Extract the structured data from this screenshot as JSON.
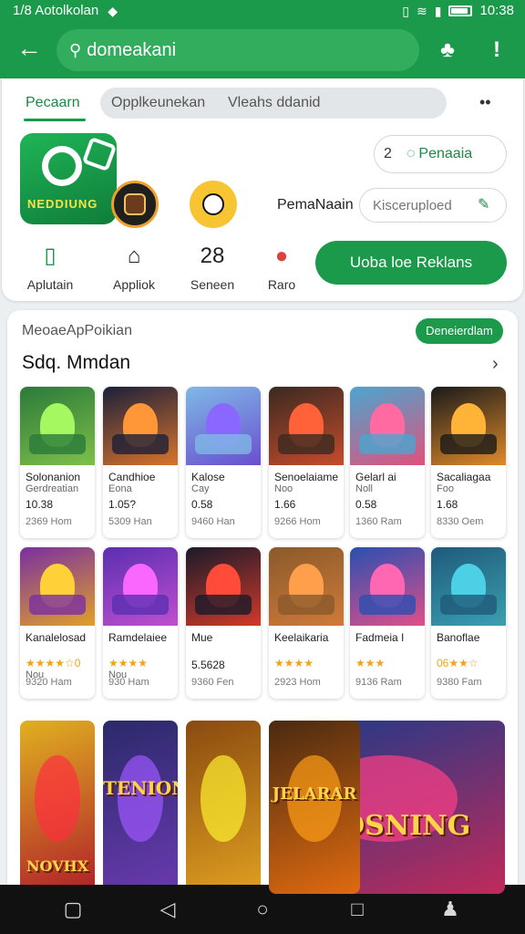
{
  "status": {
    "left_text": "1/8 Aotolkolan",
    "time": "10:38"
  },
  "appbar": {
    "search_query": "domeakani"
  },
  "header": {
    "tab_active": "Pecaarn",
    "tab_pill_1": "Opplkeunekan",
    "tab_pill_2": "Vleahs ddanid",
    "logo_text": "NEDDIUNG",
    "pill_search_num": "2",
    "pill_search_label": "Penaaia",
    "perma_label": "PemaNaain",
    "perma_placeholder": "Kisceruploed",
    "actions": [
      {
        "icon": "clipboard-icon",
        "glyph": "▯",
        "label": "Aplutain"
      },
      {
        "icon": "pack-icon",
        "glyph": "⌂",
        "label": "Appliok"
      },
      {
        "icon": "number-icon",
        "glyph": "28",
        "label": "Seneen"
      },
      {
        "icon": "location-icon",
        "glyph": "●",
        "label": "Raro"
      }
    ],
    "cta_label": "Uoba loe Reklans"
  },
  "section": {
    "subtitle": "MeoaeApPoikian",
    "chip": "Deneierdlam",
    "title": "Sdq. Mmdan"
  },
  "tiles_row1": [
    {
      "name": "Solonanion",
      "sub": "Gerdreatian",
      "value": "10.38",
      "meta": "2369 Hom",
      "c1": "#2a7a3a",
      "c2": "#7fbf4a"
    },
    {
      "name": "Candhioe",
      "sub": "Eona",
      "value": "1.05?",
      "meta": "5309 Han",
      "c1": "#1b1f3a",
      "c2": "#d9742b"
    },
    {
      "name": "Kalose",
      "sub": "Cay",
      "value": "0.58",
      "meta": "9460 Han",
      "c1": "#7fb8e6",
      "c2": "#6a4fcf"
    },
    {
      "name": "Senoelaiame",
      "sub": "Noo",
      "value": "1.66",
      "meta": "9266 Hom",
      "c1": "#3a2a20",
      "c2": "#c74b2c"
    },
    {
      "name": "Gelarl ai",
      "sub": "Noll",
      "value": "0.58",
      "meta": "1360 Ram",
      "c1": "#4aa6cf",
      "c2": "#e0527c"
    },
    {
      "name": "Sacaliagaa",
      "sub": "Foo",
      "value": "1.68",
      "meta": "8330 Oem",
      "c1": "#1a1a1a",
      "c2": "#e08a2a"
    }
  ],
  "tiles_row2": [
    {
      "name": "Kanalelosad",
      "stars": "★★★★☆0",
      "sub": "Nou",
      "meta": "9320 Ham",
      "c1": "#7a2fa0",
      "c2": "#e0a02a"
    },
    {
      "name": "Ramdelaiee",
      "stars": "★★★★",
      "sub": "Nou",
      "meta": "930 Ham",
      "c1": "#5a2fb0",
      "c2": "#c04fd0"
    },
    {
      "name": "Mue",
      "value": "5.5628",
      "sub": "",
      "meta": "9360 Fen",
      "c1": "#1a1a2a",
      "c2": "#d03a2a"
    },
    {
      "name": "Keelaikaria",
      "stars": "★★★★",
      "sub": "",
      "meta": "2923 Hom",
      "c1": "#8a5a2a",
      "c2": "#d07a3a"
    },
    {
      "name": "Fadmeia I",
      "stars": "★★★",
      "sub": "",
      "meta": "9136 Ram",
      "c1": "#2a4fb0",
      "c2": "#e04f8a"
    },
    {
      "name": "Banoflae",
      "stars": "06★★☆",
      "sub": "",
      "meta": "9380 Fam",
      "c1": "#1f5a7a",
      "c2": "#3aa0b0"
    }
  ],
  "promos": [
    {
      "text": "NOVHX",
      "c1": "#e0b020",
      "c2": "#b01f2a"
    },
    {
      "text": "TENION",
      "c1": "#2a2a6a",
      "c2": "#6a3ab0"
    },
    {
      "text": "",
      "c1": "#8a4a10",
      "c2": "#e0a020"
    },
    {
      "text": "JELARAR",
      "c1": "#4a2a10",
      "c2": "#e06a10"
    },
    {
      "text": "NIDSNING",
      "c1": "#1a3a8a",
      "c2": "#c02a5a"
    }
  ],
  "colors": {
    "brand": "#1a9a4a",
    "brand_light": "#32ad5e",
    "star": "#f2a31a"
  }
}
